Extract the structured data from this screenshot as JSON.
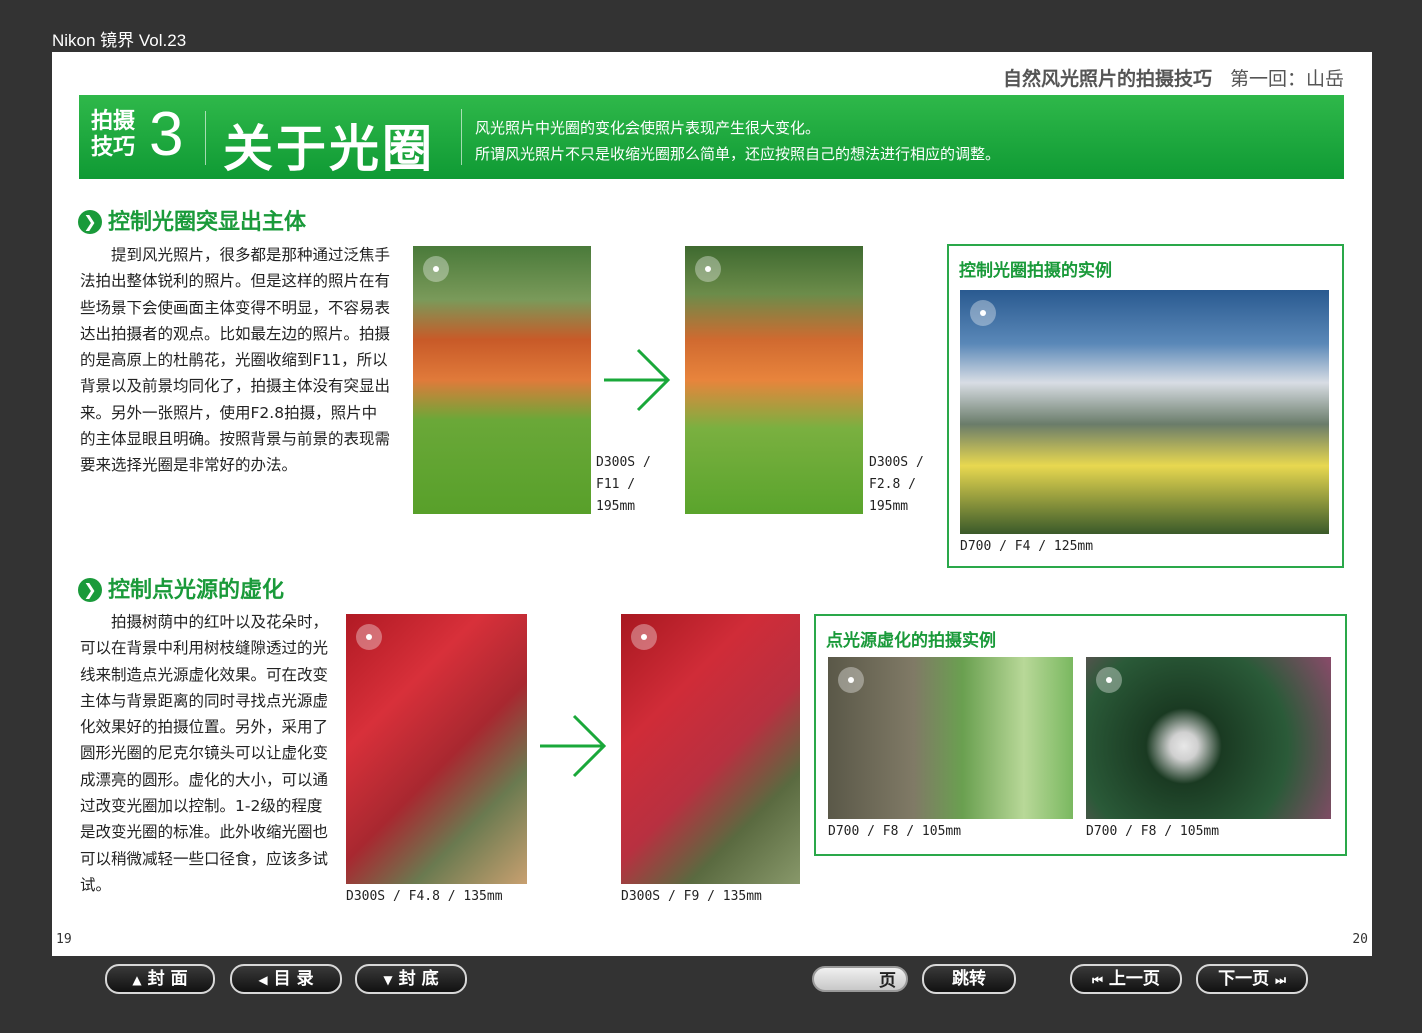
{
  "app": {
    "title": "Nikon 镜界 Vol.23"
  },
  "header": {
    "title": "自然风光照片的拍摄技巧",
    "episode": "第一回：山岳"
  },
  "banner": {
    "tag_line1": "拍摄",
    "tag_line2": "技巧",
    "number": "3",
    "heading": "关于光圈",
    "desc_line1": "风光照片中光圈的变化会使照片表现产生很大变化。",
    "desc_line2": "所谓风光照片不只是收缩光圈那么简单，还应按照自己的想法进行相应的调整。"
  },
  "section1": {
    "title": "控制光圈突显出主体",
    "text": "提到风光照片，很多都是那种通过泛焦手法拍出整体锐利的照片。但是这样的照片在有些场景下会使画面主体变得不明显，不容易表达出拍摄者的观点。比如最左边的照片。拍摄的是高原上的杜鹃花，光圈收缩到F11，所以背景以及前景均同化了，拍摄主体没有突显出来。另外一张照片，使用F2.8拍摄，照片中的主体显眼且明确。按照背景与前景的表现需要来选择光圈是非常好的办法。",
    "photo1_caption_1": "D300S /",
    "photo1_caption_2": "F11 /",
    "photo1_caption_3": "195mm",
    "photo2_caption_1": "D300S /",
    "photo2_caption_2": "F2.8 /",
    "photo2_caption_3": "195mm",
    "box_title": "控制光圈拍摄的实例",
    "box_caption": "D700 / F4 / 125mm"
  },
  "section2": {
    "title": "控制点光源的虚化",
    "text": "拍摄树荫中的红叶以及花朵时，可以在背景中利用树枝缝隙透过的光线来制造点光源虚化效果。可在改变主体与背景距离的同时寻找点光源虚化效果好的拍摄位置。另外，采用了圆形光圈的尼克尔镜头可以让虚化变成漂亮的圆形。虚化的大小，可以通过改变光圈加以控制。1-2级的程度是改变光圈的标准。此外收缩光圈也可以稍微减轻一些口径食，应该多试试。",
    "photo1_caption": "D300S / F4.8 / 135mm",
    "photo2_caption": "D300S / F9 / 135mm",
    "box_title": "点光源虚化的拍摄实例",
    "box_caption1": "D700 / F8 / 105mm",
    "box_caption2": "D700 / F8 / 105mm"
  },
  "page_numbers": {
    "left": "19",
    "right": "20"
  },
  "toolbar": {
    "cover": "封 面",
    "contents": "目 录",
    "back_cover": "封 底",
    "page_label": "页",
    "jump": "跳转",
    "prev": "上一页",
    "next": "下一页"
  },
  "icons": [
    "up-triangle-icon",
    "left-triangle-icon",
    "down-triangle-icon",
    "skip-back-icon",
    "skip-forward-icon",
    "aperture-marker-icon",
    "right-arrow-icon",
    "chevron-right-icon"
  ],
  "colors": {
    "accent_green": "#1a9a3a",
    "banner_green": "#2fb84a",
    "background": "#333333"
  }
}
